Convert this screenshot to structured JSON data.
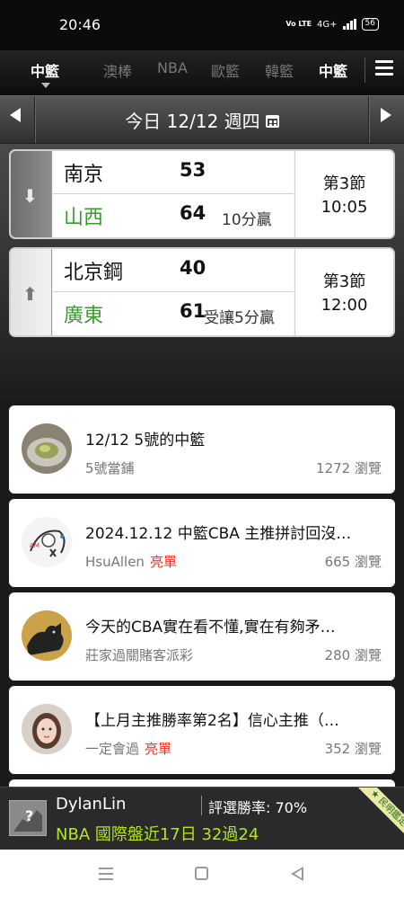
{
  "status_bar": {
    "time": "20:46",
    "network": "4G+",
    "volte": "Vo LTE",
    "battery": "56"
  },
  "league_tabs": {
    "items": [
      {
        "label": "中籃",
        "active": true
      },
      {
        "label": "澳棒"
      },
      {
        "label": "NBA"
      },
      {
        "label": "歐籃"
      },
      {
        "label": "韓籃"
      },
      {
        "label": "中籃"
      }
    ]
  },
  "date_bar": {
    "label": "今日 12/12 週四"
  },
  "matches": [
    {
      "direction": "down",
      "home": {
        "name": "南京",
        "score": "53",
        "note": ""
      },
      "away": {
        "name": "山西",
        "score": "64",
        "note": "10分贏"
      },
      "period": "第3節",
      "time": "10:05"
    },
    {
      "direction": "up",
      "home": {
        "name": "北京鋼",
        "score": "40",
        "note": ""
      },
      "away": {
        "name": "廣東",
        "score": "61",
        "note": "受讓5分贏"
      },
      "period": "第3節",
      "time": "12:00"
    }
  ],
  "articles": [
    {
      "title": "12/12 5號的中籃",
      "author": "5號當鋪",
      "tag": "",
      "views": "1272 瀏覽"
    },
    {
      "title": "2024.12.12 中籃CBA 主推拼討回沒…",
      "author": "HsuAllen",
      "tag": "亮單",
      "views": "665 瀏覽"
    },
    {
      "title": "今天的CBA實在看不懂,實在有夠矛…",
      "author": "莊家過關賭客派彩",
      "tag": "",
      "views": "280 瀏覽"
    },
    {
      "title": "【上月主推勝率第2名】信心主推（…",
      "author": "一定會過",
      "tag": "亮單",
      "views": "352 瀏覽"
    }
  ],
  "expert_bar": {
    "name": "DylanLin",
    "win_rate": "評選勝率: 70%",
    "record": "NBA 國際盤近17日 32過24",
    "ribbon": "★ 民明鑑定 ★"
  }
}
